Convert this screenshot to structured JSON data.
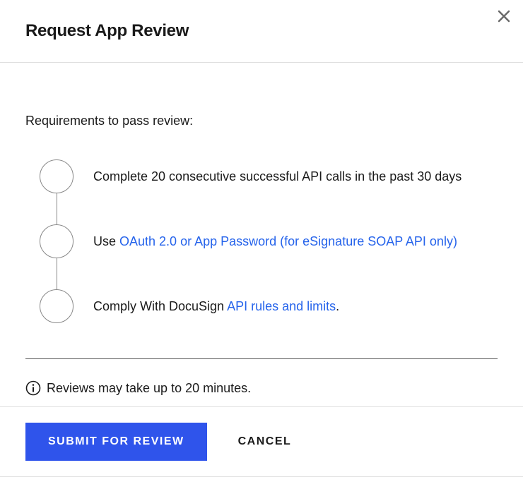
{
  "header": {
    "title": "Request App Review"
  },
  "content": {
    "subheading": "Requirements to pass review:",
    "requirements": [
      {
        "prefix": "",
        "text": "Complete 20 consecutive successful API calls in the past 30 days",
        "link": "",
        "suffix": ""
      },
      {
        "prefix": "Use ",
        "text": "",
        "link": "OAuth 2.0 or App Password (for eSignature SOAP API only)",
        "suffix": ""
      },
      {
        "prefix": "Comply With DocuSign ",
        "text": "",
        "link": "API rules and limits",
        "suffix": "."
      }
    ],
    "info": "Reviews may take up to 20 minutes."
  },
  "footer": {
    "submit_label": "SUBMIT FOR REVIEW",
    "cancel_label": "CANCEL"
  }
}
